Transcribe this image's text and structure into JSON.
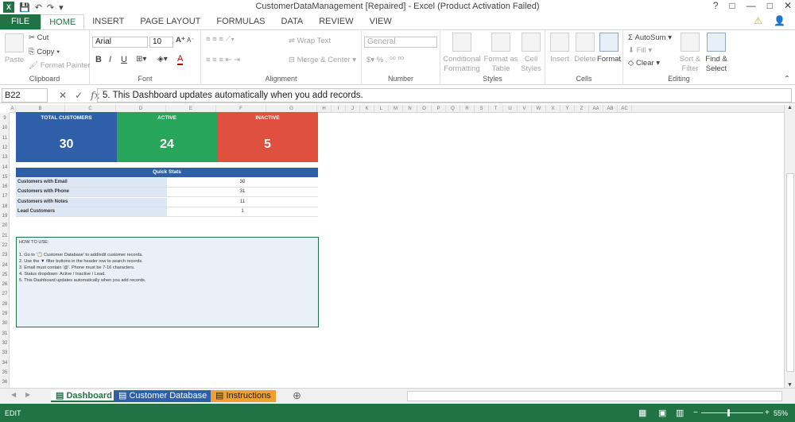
{
  "window": {
    "title": "CustomerDataManagement [Repaired] - Excel (Product Activation Failed)",
    "controls": [
      "?",
      "□",
      "—",
      "□",
      "✕"
    ]
  },
  "ribbon_tabs": [
    "FILE",
    "HOME",
    "INSERT",
    "PAGE LAYOUT",
    "FORMULAS",
    "DATA",
    "REVIEW",
    "VIEW"
  ],
  "clipboard": {
    "paste": "Paste",
    "cut": "Cut",
    "copy": "Copy",
    "format_painter": "Format Painter",
    "label": "Clipboard"
  },
  "font": {
    "name": "Arial",
    "size": "10",
    "label": "Font",
    "bold": "B",
    "italic": "I",
    "underline": "U",
    "grow": "A",
    "shrink": "A"
  },
  "alignment": {
    "wrap": "Wrap Text",
    "merge": "Merge & Center",
    "label": "Alignment"
  },
  "number": {
    "format": "General",
    "label": "Number"
  },
  "styles": {
    "conditional": "Conditional Formatting",
    "format_table": "Format as Table",
    "cell_styles": "Cell Styles",
    "label": "Styles"
  },
  "cells": {
    "insert": "Insert",
    "delete": "Delete",
    "format": "Format",
    "label": "Cells"
  },
  "editing": {
    "autosum": "AutoSum",
    "fill": "Fill",
    "clear": "Clear",
    "sort": "Sort & Filter",
    "find": "Find & Select",
    "label": "Editing"
  },
  "formula_bar": {
    "name_box": "B22",
    "content": "5. This Dashboard updates automatically when you add records."
  },
  "columns": [
    "A",
    "B",
    "C",
    "D",
    "E",
    "F",
    "G",
    "H",
    "I",
    "J",
    "K",
    "L",
    "M",
    "N",
    "O",
    "P",
    "Q",
    "R",
    "S",
    "T",
    "U",
    "V",
    "W",
    "X",
    "Y",
    "Z",
    "AA",
    "AB",
    "AC"
  ],
  "rows": [
    "9",
    "10",
    "11",
    "12",
    "13",
    "14",
    "15",
    "16",
    "17",
    "18",
    "19",
    "20",
    "21",
    "22",
    "23",
    "24",
    "25",
    "26",
    "27",
    "28",
    "29",
    "30",
    "31",
    "32",
    "33",
    "34",
    "35",
    "36"
  ],
  "kpis": [
    {
      "label": "TOTAL CUSTOMERS",
      "value": "30",
      "color": "#2e5fa8"
    },
    {
      "label": "ACTIVE",
      "value": "24",
      "color": "#27a55a"
    },
    {
      "label": "INACTIVE",
      "value": "5",
      "color": "#e0503f"
    }
  ],
  "quick_stats": {
    "title": "Quick Stats",
    "rows": [
      {
        "label": "Customers with Email",
        "value": "30"
      },
      {
        "label": "Customers with Phone",
        "value": "31"
      },
      {
        "label": "Customers with Notes",
        "value": "11"
      },
      {
        "label": "Lead Customers",
        "value": "1"
      }
    ]
  },
  "how_to": {
    "title": "HOW TO USE:",
    "lines": [
      "1. Go to '📋 Customer Database' to add/edit customer records.",
      "2. Use the ▼ filter buttons in the header row to search records.",
      "3. Email must contain '@'. Phone must be 7-16 characters.",
      "4. Status dropdown: Active / Inactive / Lead.",
      "5. This Dashboard updates automatically when you add records."
    ]
  },
  "sheets": [
    {
      "label": "Dashboard",
      "color": "#217346"
    },
    {
      "label": "Customer Database",
      "color": "#2e5fa8"
    },
    {
      "label": "Instructions",
      "color": "#f0a030"
    }
  ],
  "status": {
    "mode": "EDIT",
    "zoom": "55%"
  }
}
